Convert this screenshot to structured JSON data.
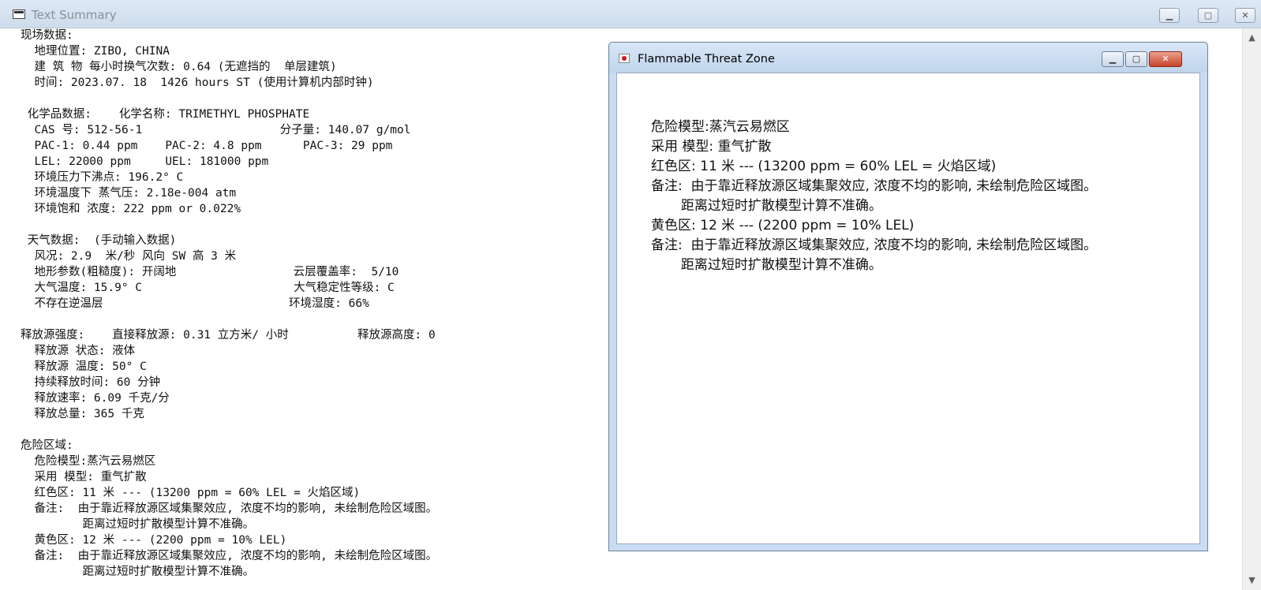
{
  "window": {
    "title": "Text Summary",
    "min_glyph": "▁",
    "max_glyph": "▢",
    "close_glyph": "✕"
  },
  "scrollbar": {
    "up": "▲",
    "down": "▼"
  },
  "lines": [
    "现场数据:",
    "  地理位置: ZIBO, CHINA",
    "  建 筑 物 每小时换气次数: 0.64 (无遮挡的  单层建筑)",
    "  时间: 2023.07. 18  1426 hours ST (使用计算机内部时钟)",
    "",
    " 化学品数据:    化学名称: TRIMETHYL PHOSPHATE",
    "  CAS 号: 512-56-1                    分子量: 140.07 g/mol",
    "  PAC-1: 0.44 ppm    PAC-2: 4.8 ppm      PAC-3: 29 ppm",
    "  LEL: 22000 ppm     UEL: 181000 ppm",
    "  环境压力下沸点: 196.2° C",
    "  环境温度下 蒸气压: 2.18e-004 atm",
    "  环境饱和 浓度: 222 ppm or 0.022%",
    "",
    " 天气数据:  (手动输入数据)",
    "  风况: 2.9  米/秒 风向 SW 高 3 米",
    "  地形参数(粗糙度): 开阔地                 云层覆盖率:  5/10",
    "  大气温度: 15.9° C                      大气稳定性等级: C",
    "  不存在逆温层                           环境湿度: 66%",
    "",
    "释放源强度:    直接释放源: 0.31 立方米/ 小时          释放源高度: 0",
    "  释放源 状态: 液体",
    "  释放源 温度: 50° C",
    "  持续释放时间: 60 分钟",
    "  释放速率: 6.09 千克/分",
    "  释放总量: 365 千克",
    "",
    "危险区域:",
    "  危险模型:蒸汽云易燃区",
    "  采用 模型: 重气扩散",
    "  红色区: 11 米 --- (13200 ppm = 60% LEL = 火焰区域)",
    "  备注:  由于靠近释放源区域集聚效应, 浓度不均的影响, 未绘制危险区域图。",
    "         距离过短时扩散模型计算不准确。",
    "  黄色区: 12 米 --- (2200 ppm = 10% LEL)",
    "  备注:  由于靠近释放源区域集聚效应, 浓度不均的影响, 未绘制危险区域图。",
    "         距离过短时扩散模型计算不准确。"
  ],
  "child": {
    "title": "Flammable Threat Zone",
    "min_glyph": "▁",
    "max_glyph": "▢",
    "close_glyph": "✕",
    "lines": [
      "危险模型:蒸汽云易燃区",
      "采用 模型: 重气扩散",
      "红色区: 11 米 --- (13200 ppm = 60% LEL = 火焰区域)",
      "备注:  由于靠近释放源区域集聚效应, 浓度不均的影响, 未绘制危险区域图。",
      "       距离过短时扩散模型计算不准确。",
      "黄色区: 12 米 --- (2200 ppm = 10% LEL)",
      "备注:  由于靠近释放源区域集聚效应, 浓度不均的影响, 未绘制危险区域图。",
      "       距离过短时扩散模型计算不准确。"
    ]
  }
}
